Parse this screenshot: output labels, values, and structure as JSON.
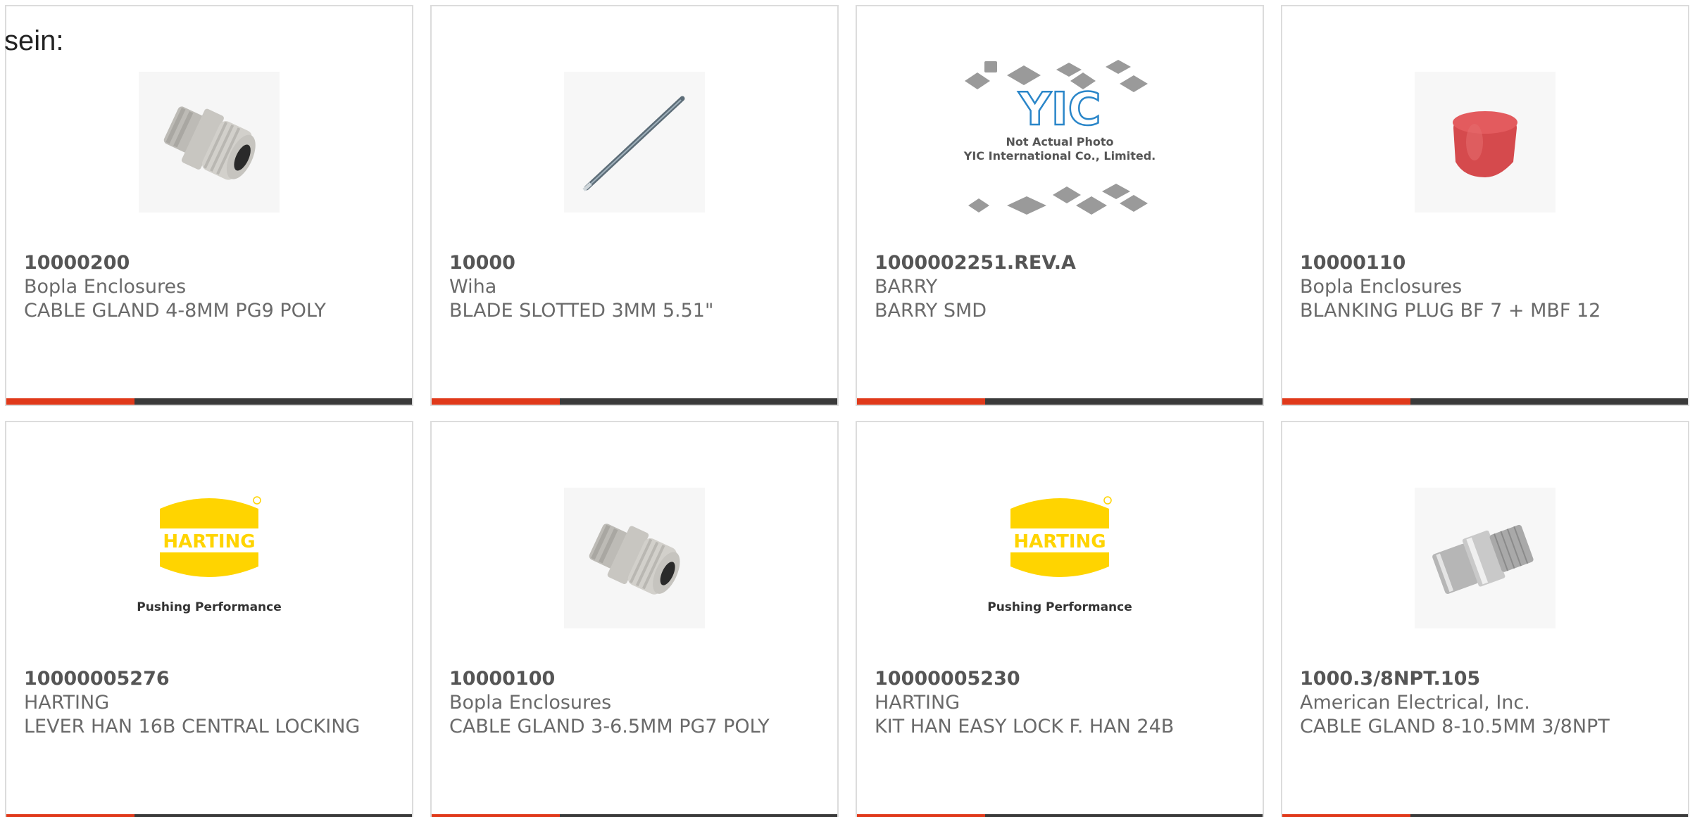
{
  "intro_text": "sein:",
  "colors": {
    "accent_bar": "#e0391a",
    "dark_bar": "#3a3a3a",
    "harting_yellow": "#ffd400"
  },
  "products": [
    {
      "part_number": "10000200",
      "manufacturer": "Bopla Enclosures",
      "description": "CABLE GLAND 4-8MM PG9 POLY",
      "image": "cable-gland-grey"
    },
    {
      "part_number": "10000",
      "manufacturer": "Wiha",
      "description": "BLADE SLOTTED 3MM 5.51\"",
      "image": "screwdriver-blade"
    },
    {
      "part_number": "1000002251.REV.A",
      "manufacturer": "BARRY",
      "description": "BARRY SMD",
      "image": "yic-placeholder",
      "image_text": {
        "logo": "YIC",
        "line1": "Not Actual Photo",
        "line2": "YIC International Co., Limited."
      }
    },
    {
      "part_number": "10000110",
      "manufacturer": "Bopla Enclosures",
      "description": "BLANKING PLUG BF 7 + MBF 12",
      "image": "red-blanking-plug"
    },
    {
      "part_number": "10000005276",
      "manufacturer": "HARTING",
      "description": "LEVER HAN 16B CENTRAL LOCKING",
      "image": "harting-logo",
      "image_text": {
        "logo": "HARTING",
        "tagline": "Pushing Performance"
      }
    },
    {
      "part_number": "10000100",
      "manufacturer": "Bopla Enclosures",
      "description": "CABLE GLAND 3-6.5MM PG7 POLY",
      "image": "cable-gland-grey"
    },
    {
      "part_number": "10000005230",
      "manufacturer": "HARTING",
      "description": "KIT HAN EASY LOCK F. HAN 24B",
      "image": "harting-logo",
      "image_text": {
        "logo": "HARTING",
        "tagline": "Pushing Performance"
      }
    },
    {
      "part_number": "1000.3/8NPT.105",
      "manufacturer": "American Electrical, Inc.",
      "description": "CABLE GLAND 8-10.5MM 3/8NPT",
      "image": "metal-cable-gland"
    }
  ]
}
